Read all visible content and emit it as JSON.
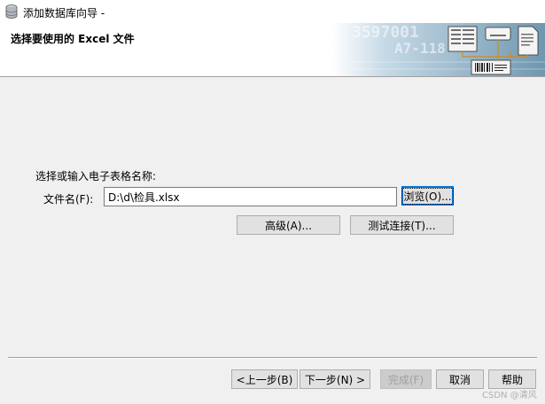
{
  "window": {
    "title": "添加数据库向导 -"
  },
  "header": {
    "heading": "选择要使用的 Excel 文件",
    "banner_text_top": "3597001",
    "banner_text_mid": "A7-118"
  },
  "form": {
    "prompt_label": "选择或输入电子表格名称:",
    "file_name_label": "文件名(F):",
    "file_name_value": "D:\\d\\检具.xlsx",
    "browse_button": "浏览(O)...",
    "advanced_button": "高级(A)...",
    "test_connection_button": "测试连接(T)..."
  },
  "footer": {
    "back_button": "<上一步(B)",
    "next_button": "下一步(N) >",
    "finish_button": "完成(F)",
    "cancel_button": "取消",
    "help_button": "帮助"
  },
  "watermark": "CSDN @清风"
}
